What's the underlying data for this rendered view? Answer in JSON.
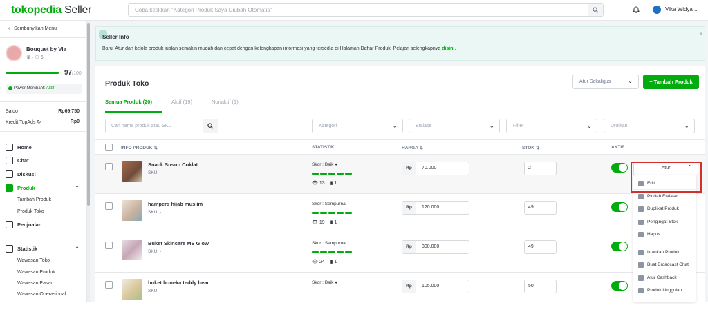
{
  "topbar": {
    "logo_main": "tokopedia",
    "logo_sub": "Seller",
    "search_placeholder": "Coba ketikkan \"Kategori Produk Saya Diubah Otomatis\"",
    "user_name": "Vika Widya ..."
  },
  "sidebar": {
    "hide_label": "Sembunyikan Menu",
    "shop_name": "Bouquet by Via",
    "shop_followers": "5",
    "score": "97",
    "score_max": "/100",
    "power_merchant_label": "Power Merchant:",
    "power_merchant_status": "Aktif",
    "saldo_label": "Saldo",
    "saldo_value": "Rp69.750",
    "topads_label": "Kredit TopAds",
    "topads_value": "Rp0",
    "nav": {
      "home": "Home",
      "chat": "Chat",
      "diskusi": "Diskusi",
      "produk": "Produk",
      "tambah_produk": "Tambah Produk",
      "produk_toko": "Produk Toko",
      "penjualan": "Penjualan",
      "statistik": "Statistik",
      "wawasan_toko": "Wawasan Toko",
      "wawasan_produk": "Wawasan Produk",
      "wawasan_pasar": "Wawasan Pasar",
      "wawasan_operasional": "Wawasan Operasional"
    }
  },
  "info": {
    "title": "Seller Info",
    "message": "Baru! Atur dan kelola produk jualan semakin mudah dan cepat dengan kelengkapan informasi yang tersedia di Halaman Daftar Produk. Pelajari selengkapnya ",
    "link": "disini",
    "period": "."
  },
  "products_page": {
    "title": "Produk Toko",
    "bulk_label": "Atur Sekaligus",
    "add_button": "+ Tambah Produk",
    "tabs": [
      "Semua Produk (20)",
      "Aktif (19)",
      "Nonaktif (1)"
    ],
    "search_placeholder": "Cari nama produk atau SKU",
    "filters": [
      "Kategori",
      "Etalase",
      "Filter",
      "Urutkan"
    ],
    "headers": {
      "info": "INFO PRODUK",
      "statistik": "STATISTIK",
      "harga": "HARGA",
      "stok": "STOK",
      "aktif": "AKTIF"
    },
    "rows": [
      {
        "name": "Snack Susun Coklat",
        "sku": "SKU: -",
        "skor": "Skor : Baik",
        "views": "13",
        "sold": "1",
        "price": "70.000",
        "stock": "2"
      },
      {
        "name": "hampers hijab muslim",
        "sku": "SKU: -",
        "skor": "Skor : Sempurna",
        "views": "19",
        "sold": "1",
        "price": "120.000",
        "stock": "49"
      },
      {
        "name": "Buket Skincare MS Glow",
        "sku": "SKU: -",
        "skor": "Skor : Sempurna",
        "views": "24",
        "sold": "1",
        "price": "300.000",
        "stock": "49"
      },
      {
        "name": "buket boneka teddy bear",
        "sku": "SKU: -",
        "skor": "Skor : Baik",
        "views": "",
        "sold": "",
        "price": "105.000",
        "stock": "50"
      }
    ],
    "currency": "Rp",
    "atur_label": "Atur"
  },
  "action_menu": {
    "edit": "Edit",
    "pindah_etalase": "Pindah Etalase",
    "duplikat": "Duplikat Produk",
    "pengingat_stok": "Pengingat Stok",
    "hapus": "Hapus",
    "iklankan": "Iklankan Produk",
    "broadcast": "Buat Broadcast Chat",
    "cashback": "Atur Cashback",
    "unggulan": "Produk Unggulan"
  },
  "colors": {
    "brand": "#03ac0e",
    "highlight": "#d32f2f"
  }
}
